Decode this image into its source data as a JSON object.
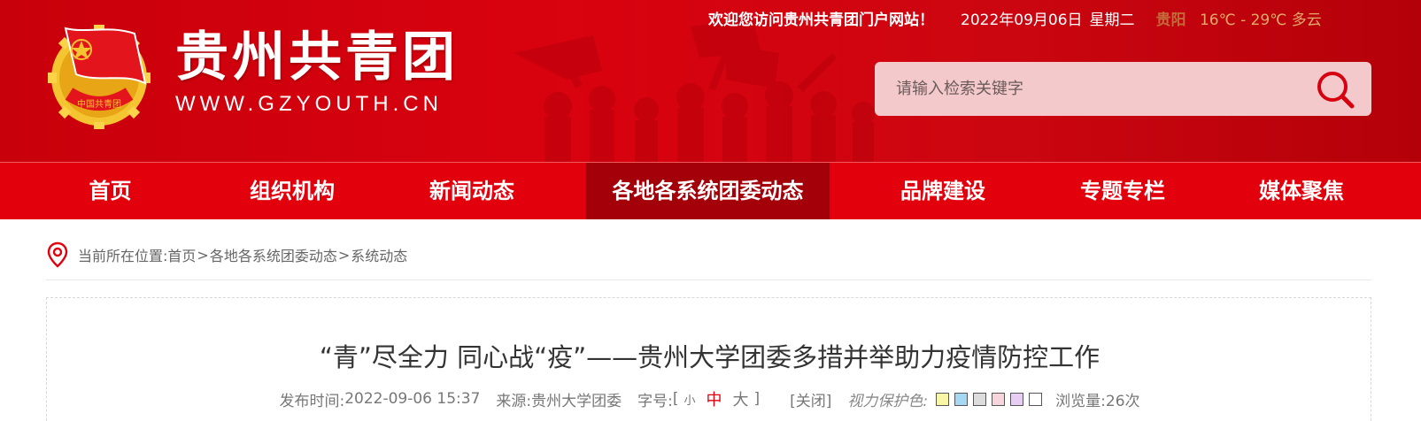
{
  "header": {
    "logo_title": "贵州共青团",
    "logo_url": "WWW.GZYOUTH.CN",
    "logo_badge_text": "中国共青团",
    "welcome": "欢迎您访问贵州共青团门户网站！",
    "date": "2022年09月06日",
    "weekday": "星期二",
    "weather_city": "贵阳",
    "weather_temp": "16℃ - 29℃",
    "weather_cond": "多云",
    "colors": {
      "brand_red": "#d9020f",
      "nav_red": "#e2000c",
      "nav_active": "#a30009"
    }
  },
  "search": {
    "placeholder": "请输入检索关键字",
    "button_icon": "search-icon"
  },
  "nav": {
    "items": [
      {
        "label": "首页"
      },
      {
        "label": "组织机构"
      },
      {
        "label": "新闻动态"
      },
      {
        "label": "各地各系统团委动态",
        "active": true
      },
      {
        "label": "品牌建设"
      },
      {
        "label": "专题专栏"
      },
      {
        "label": "媒体聚焦"
      }
    ]
  },
  "breadcrumb": {
    "icon": "location-pin-icon",
    "prefix": "当前所在位置:",
    "crumbs": [
      "首页",
      "各地各系统团委动态",
      "系统动态"
    ],
    "separator": ">"
  },
  "article": {
    "title": "“青”尽全力 同心战“疫”——贵州大学团委多措并举助力疫情防控工作",
    "publish_label": "发布时间:",
    "publish_time": "2022-09-06 15:37",
    "source_label": "来源:",
    "source": "贵州大学团委",
    "font_size_label": "字号:",
    "bracket_open": "[",
    "bracket_close": "]",
    "font_small": "小",
    "font_medium": "中",
    "font_large": "大",
    "close_label": "[关闭]",
    "eye_care_label": "视力保护色:",
    "eye_care_colors": [
      "#faf6a8",
      "#a6d8f3",
      "#dcdcdc",
      "#f6d6dc",
      "#e6cdf2",
      "#ffffff"
    ],
    "views_label": "浏览量:",
    "views": "26次"
  }
}
